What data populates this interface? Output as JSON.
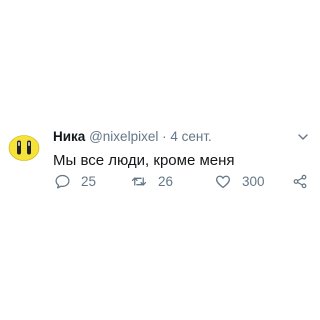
{
  "tweet": {
    "author_name": "Ника",
    "author_handle": "@nixelpixel",
    "separator": "·",
    "date": "4 сент.",
    "text": "Мы все люди, кроме меня",
    "avatar_icon": "yellow-face-emoji",
    "menu_icon": "chevron-down-icon",
    "actions": {
      "reply": {
        "icon": "reply-icon",
        "count": "25"
      },
      "retweet": {
        "icon": "retweet-icon",
        "count": "26"
      },
      "like": {
        "icon": "heart-icon",
        "count": "300"
      },
      "share": {
        "icon": "share-icon"
      }
    },
    "colors": {
      "text": "#14171a",
      "secondary": "#657786",
      "avatar_yellow": "#f5e23a",
      "background": "#ffffff"
    }
  }
}
